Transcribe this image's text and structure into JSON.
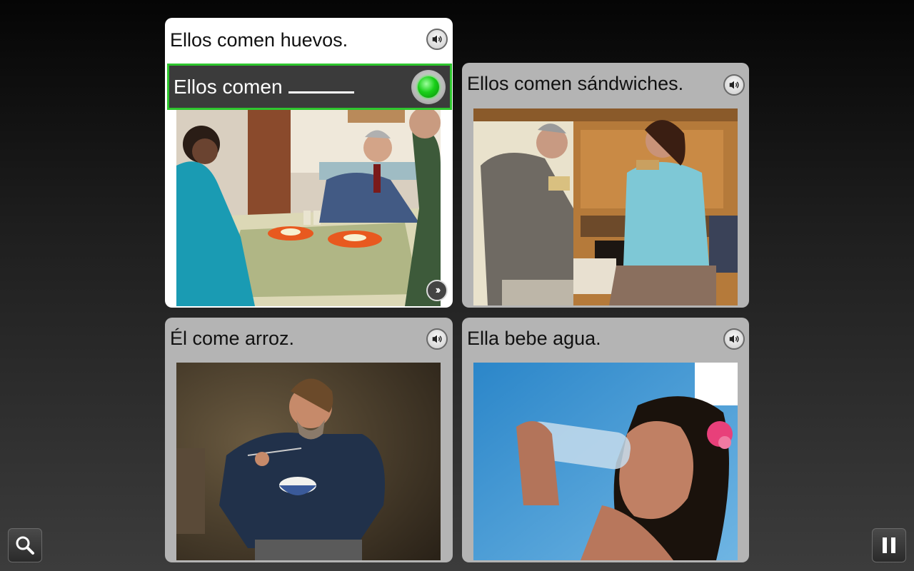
{
  "prompt": {
    "text": "Ellos comen",
    "status": "listening"
  },
  "cards": [
    {
      "caption": "Ellos comen huevos.",
      "image": "people eating eggs at a table",
      "active": true
    },
    {
      "caption": "Ellos comen sándwiches.",
      "image": "man and woman eating sandwiches",
      "active": false
    },
    {
      "caption": "Él come arroz.",
      "image": "man eating rice from a bowl",
      "active": false
    },
    {
      "caption": "Ella bebe agua.",
      "image": "woman drinking water from a bottle",
      "active": false
    }
  ],
  "icons": {
    "speaker": "speaker-icon",
    "microphone": "microphone-icon",
    "next": "next-icon",
    "search": "magnifier-icon",
    "pause": "pause-icon"
  },
  "colors": {
    "active_border": "#2ec62e",
    "card_bg": "#b4b4b4",
    "active_card_bg": "#ffffff",
    "prompt_bg": "#3b3b3b"
  }
}
